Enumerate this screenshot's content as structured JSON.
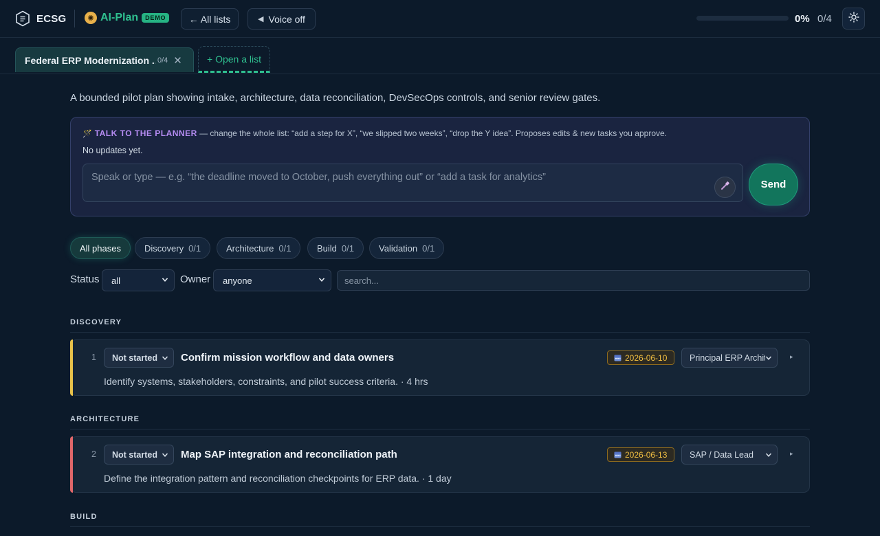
{
  "header": {
    "brand": "ECSG",
    "app_name": "AI-Plan",
    "app_badge": "DEMO",
    "all_lists_label": "← All lists",
    "voice_label": "Voice off",
    "progress_percent_label": "0%",
    "progress_count": "0/4",
    "progress_fraction": 0
  },
  "tabs": {
    "active": {
      "title": "Federal ERP Modernization ...",
      "count": "0/4"
    },
    "open_label": "+ Open a list"
  },
  "description": "A bounded pilot plan showing intake, architecture, data reconciliation, DevSecOps controls, and senior review gates.",
  "planner": {
    "label": "TALK TO THE PLANNER",
    "help": " — change the whole list: “add a step for X”, “we slipped two weeks”, “drop the Y idea”. Proposes edits & new tasks you approve.",
    "status": "No updates yet.",
    "input_placeholder": "Speak or type — e.g. “the deadline moved to October, push everything out” or “add a task for analytics”",
    "send_label": "Send"
  },
  "phases": [
    {
      "label": "All phases",
      "count": ""
    },
    {
      "label": "Discovery",
      "count": "0/1"
    },
    {
      "label": "Architecture",
      "count": "0/1"
    },
    {
      "label": "Build",
      "count": "0/1"
    },
    {
      "label": "Validation",
      "count": "0/1"
    }
  ],
  "filters": {
    "status_label": "Status",
    "status_value": "all",
    "owner_label": "Owner",
    "owner_value": "anyone",
    "search_placeholder": "search..."
  },
  "sections": [
    {
      "title": "DISCOVERY",
      "accent": "#e8c24a",
      "task": {
        "number": "1",
        "status": "Not started",
        "title": "Confirm mission workflow and data owners",
        "subtitle": "Identify systems, stakeholders, constraints, and pilot success criteria. · 4 hrs",
        "date": "2026-06-10",
        "owner": "Principal ERP Architect"
      }
    },
    {
      "title": "ARCHITECTURE",
      "accent": "#e0676a",
      "task": {
        "number": "2",
        "status": "Not started",
        "title": "Map SAP integration and reconciliation path",
        "subtitle": "Define the integration pattern and reconciliation checkpoints for ERP data. · 1 day",
        "date": "2026-06-13",
        "owner": "SAP / Data Lead"
      }
    },
    {
      "title": "BUILD"
    }
  ],
  "colors": {
    "background": "#0c1a2a",
    "accent_green": "#2fbf8f",
    "planner_purple": "#b58cf2",
    "date_gold": "#f0be42"
  },
  "icons": [
    "ecsg-logo-icon",
    "compass-icon",
    "speaker-muted-icon",
    "sun-icon",
    "close-icon",
    "wand-icon",
    "mic-icon",
    "calendar-icon",
    "chevron-down-icon",
    "expand-triangle-icon"
  ]
}
